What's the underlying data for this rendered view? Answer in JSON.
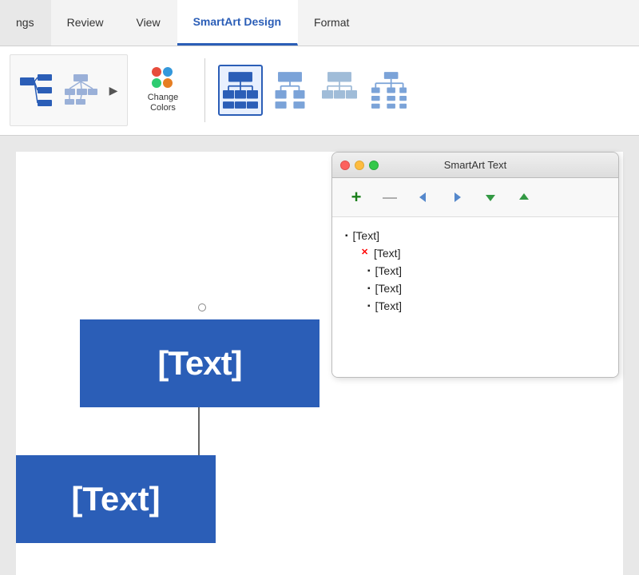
{
  "ribbon": {
    "tabs": [
      {
        "id": "ngs",
        "label": "ngs",
        "active": false
      },
      {
        "id": "review",
        "label": "Review",
        "active": false
      },
      {
        "id": "view",
        "label": "View",
        "active": false
      },
      {
        "id": "smartart-design",
        "label": "SmartArt Design",
        "active": true
      },
      {
        "id": "format",
        "label": "Format",
        "active": false
      }
    ],
    "changeColors": {
      "label": "Change\nColors",
      "dots": [
        {
          "color": "#e74c3c"
        },
        {
          "color": "#3498db"
        },
        {
          "color": "#2ecc71"
        },
        {
          "color": "#e67e22"
        }
      ]
    },
    "moreArrow": "▶",
    "layouts": {
      "selectedIndex": 0,
      "items": [
        {
          "id": "layout-1",
          "type": "hierarchy-main"
        },
        {
          "id": "layout-2",
          "type": "hierarchy-alt"
        },
        {
          "id": "layout-3",
          "type": "hierarchy-3"
        },
        {
          "id": "layout-4",
          "type": "hierarchy-4"
        }
      ]
    }
  },
  "diagram": {
    "mainText": "[Text]",
    "bottomText": "[Text]"
  },
  "smartartPanel": {
    "title": "SmartArt Text",
    "windowButtons": {
      "close": "●",
      "minimize": "●",
      "maximize": "●"
    },
    "toolbar": {
      "add": "+",
      "remove": "—",
      "left": "◀",
      "right": "▶",
      "down": "▼",
      "up": "▲"
    },
    "items": [
      {
        "id": "item-1",
        "text": "[Text]",
        "indent": false,
        "bullet": "▪",
        "hasRedX": false
      },
      {
        "id": "item-2",
        "text": "[Text]",
        "indent": true,
        "bullet": "",
        "hasRedX": true
      },
      {
        "id": "item-3",
        "text": "[Text]",
        "indent": false,
        "bullet": "▪",
        "hasRedX": false,
        "subIndent": true
      },
      {
        "id": "item-4",
        "text": "[Text]",
        "indent": false,
        "bullet": "▪",
        "hasRedX": false,
        "subIndent": true
      },
      {
        "id": "item-5",
        "text": "[Text]",
        "indent": false,
        "bullet": "▪",
        "hasRedX": false,
        "subIndent": true
      }
    ]
  }
}
